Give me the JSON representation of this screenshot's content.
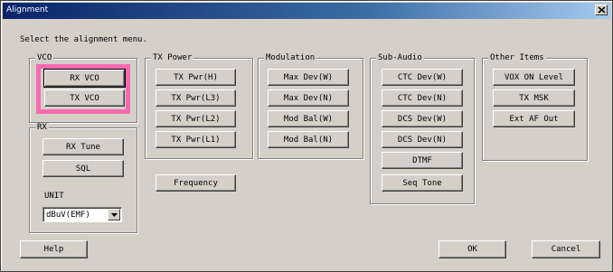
{
  "window": {
    "title": "Alignment",
    "close_icon": "close-icon"
  },
  "instruction": "Select the alignment menu.",
  "groups": {
    "vco": {
      "label": "VCO",
      "buttons": [
        "RX VCO",
        "TX VCO"
      ]
    },
    "rx": {
      "label": "RX",
      "buttons": [
        "RX Tune",
        "SQL"
      ],
      "unit_label": "UNIT",
      "unit_value": "dBuV(EMF)"
    },
    "tx_power": {
      "label": "TX Power",
      "buttons": [
        "TX Pwr(H)",
        "TX Pwr(L3)",
        "TX Pwr(L2)",
        "TX Pwr(L1)"
      ]
    },
    "modulation": {
      "label": "Modulation",
      "buttons": [
        "Max Dev(W)",
        "Max Dev(N)",
        "Mod Bal(W)",
        "Mod Bal(N)"
      ]
    },
    "sub_audio": {
      "label": "Sub-Audio",
      "buttons": [
        "CTC Dev(W)",
        "CTC Dev(N)",
        "DCS Dev(W)",
        "DCS Dev(N)",
        "DTMF",
        "Seq Tone"
      ]
    },
    "other": {
      "label": "Other Items",
      "buttons": [
        "VOX ON Level",
        "TX MSK",
        "Ext AF Out"
      ]
    }
  },
  "frequency_button": "Frequency",
  "footer": {
    "help": "Help",
    "ok": "OK",
    "cancel": "Cancel"
  },
  "colors": {
    "highlight": "#f56bb0",
    "dialog_bg": "#d4d0c8",
    "title_bar": "#0a246a"
  }
}
